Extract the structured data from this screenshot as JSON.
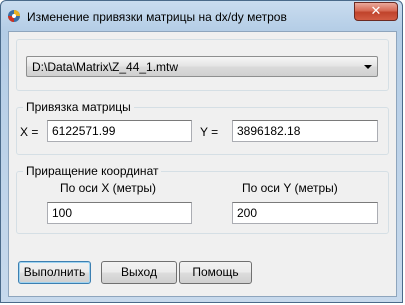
{
  "window": {
    "title": "Изменение привязки матрицы на dx/dy метров",
    "close_label": "✕"
  },
  "file_combo": {
    "value": "D:\\Data\\Matrix\\Z_44_1.mtw"
  },
  "binding_group": {
    "title": "Привязка матрицы",
    "x_label": "X =",
    "x_value": "6122571.99",
    "y_label": "Y =",
    "y_value": "3896182.18"
  },
  "increment_group": {
    "title": "Приращение координат",
    "x_axis_label": "По оси X (метры)",
    "x_value": "100",
    "y_axis_label": "По оси Y (метры)",
    "y_value": "200"
  },
  "buttons": {
    "run": "Выполнить",
    "exit": "Выход",
    "help": "Помощь"
  }
}
